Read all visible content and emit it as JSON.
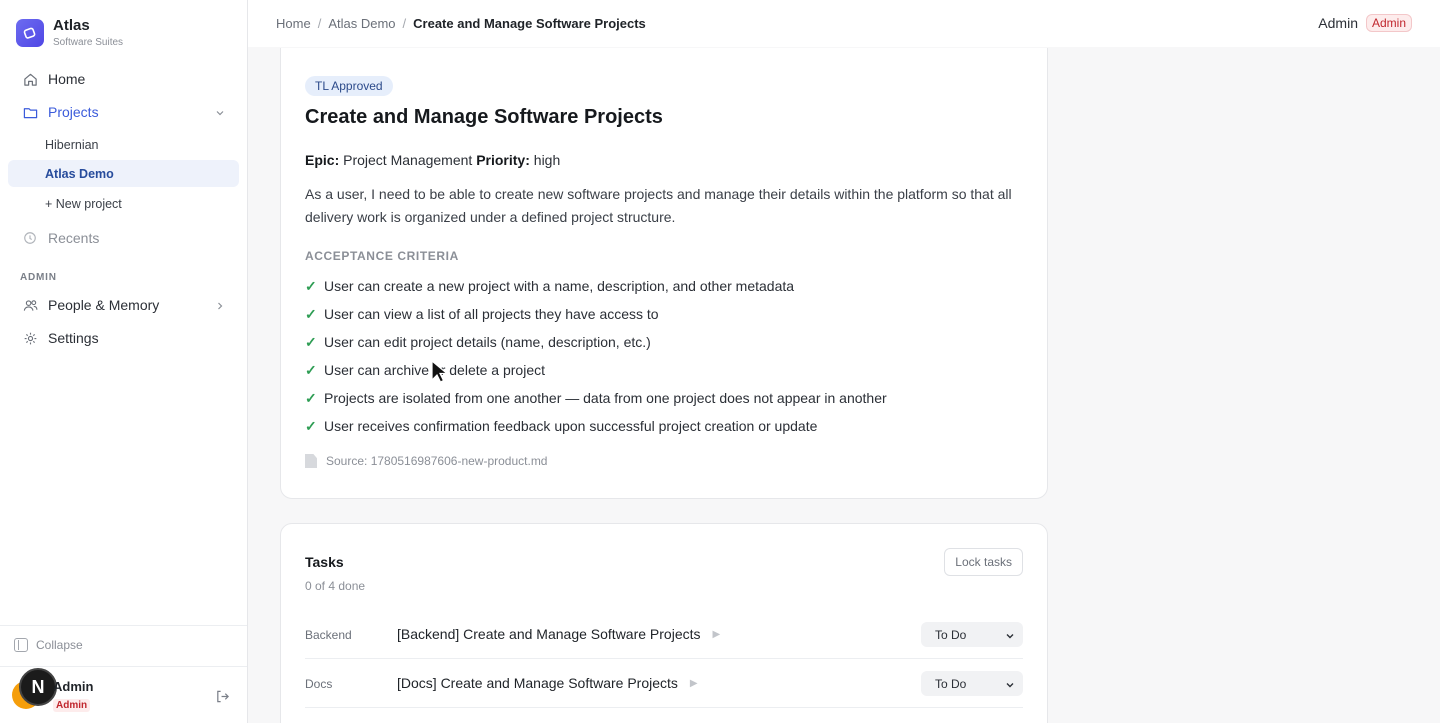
{
  "brand": {
    "name": "Atlas",
    "subtitle": "Software Suites",
    "icon": "atlas-logo-icon"
  },
  "sidebar": {
    "nav": [
      {
        "label": "Home",
        "icon": "home-icon"
      },
      {
        "label": "Projects",
        "icon": "folder-icon"
      }
    ],
    "projects": [
      "Hibernian",
      "Atlas Demo",
      "+ New project"
    ],
    "recents_label": "Recents",
    "admin_section": "ADMIN",
    "admin_items": [
      {
        "label": "People & Memory",
        "icon": "people-icon"
      },
      {
        "label": "Settings",
        "icon": "gear-icon"
      }
    ],
    "collapse_label": "Collapse",
    "user": {
      "initial": "N",
      "name": "Admin",
      "role": "Admin"
    }
  },
  "header": {
    "breadcrumb": [
      "Home",
      "Atlas Demo",
      "Create and Manage Software Projects"
    ],
    "user_name": "Admin",
    "user_badge": "Admin"
  },
  "story": {
    "status": "TL Approved",
    "title": "Create and Manage Software Projects",
    "epic_label": "Epic:",
    "epic": "Project Management",
    "priority_label": "Priority:",
    "priority": "high",
    "description": "As a user, I need to be able to create new software projects and manage their details within the platform so that all delivery work is organized under a defined project structure.",
    "acceptance_label": "ACCEPTANCE CRITERIA",
    "acceptance_criteria": [
      "User can create a new project with a name, description, and other metadata",
      "User can view a list of all projects they have access to",
      "User can edit project details (name, description, etc.)",
      "User can archive or delete a project",
      "Projects are isolated from one another — data from one project does not appear in another",
      "User receives confirmation feedback upon successful project creation or update"
    ],
    "check_glyph": "✓",
    "source": "Source: 1780516987606-new-product.md"
  },
  "tasks": {
    "title": "Tasks",
    "progress": "0 of 4 done",
    "lock_label": "Lock tasks",
    "rows": [
      {
        "tag": "Backend",
        "title": "[Backend] Create and Manage Software Projects",
        "status": "To Do"
      },
      {
        "tag": "Docs",
        "title": "[Docs] Create and Manage Software Projects",
        "status": "To Do"
      }
    ]
  },
  "colors": {
    "accent": "#3b5bdb",
    "brand": "#5b5be8",
    "check": "#2e9d54",
    "admin_badge": "#c0262d"
  }
}
